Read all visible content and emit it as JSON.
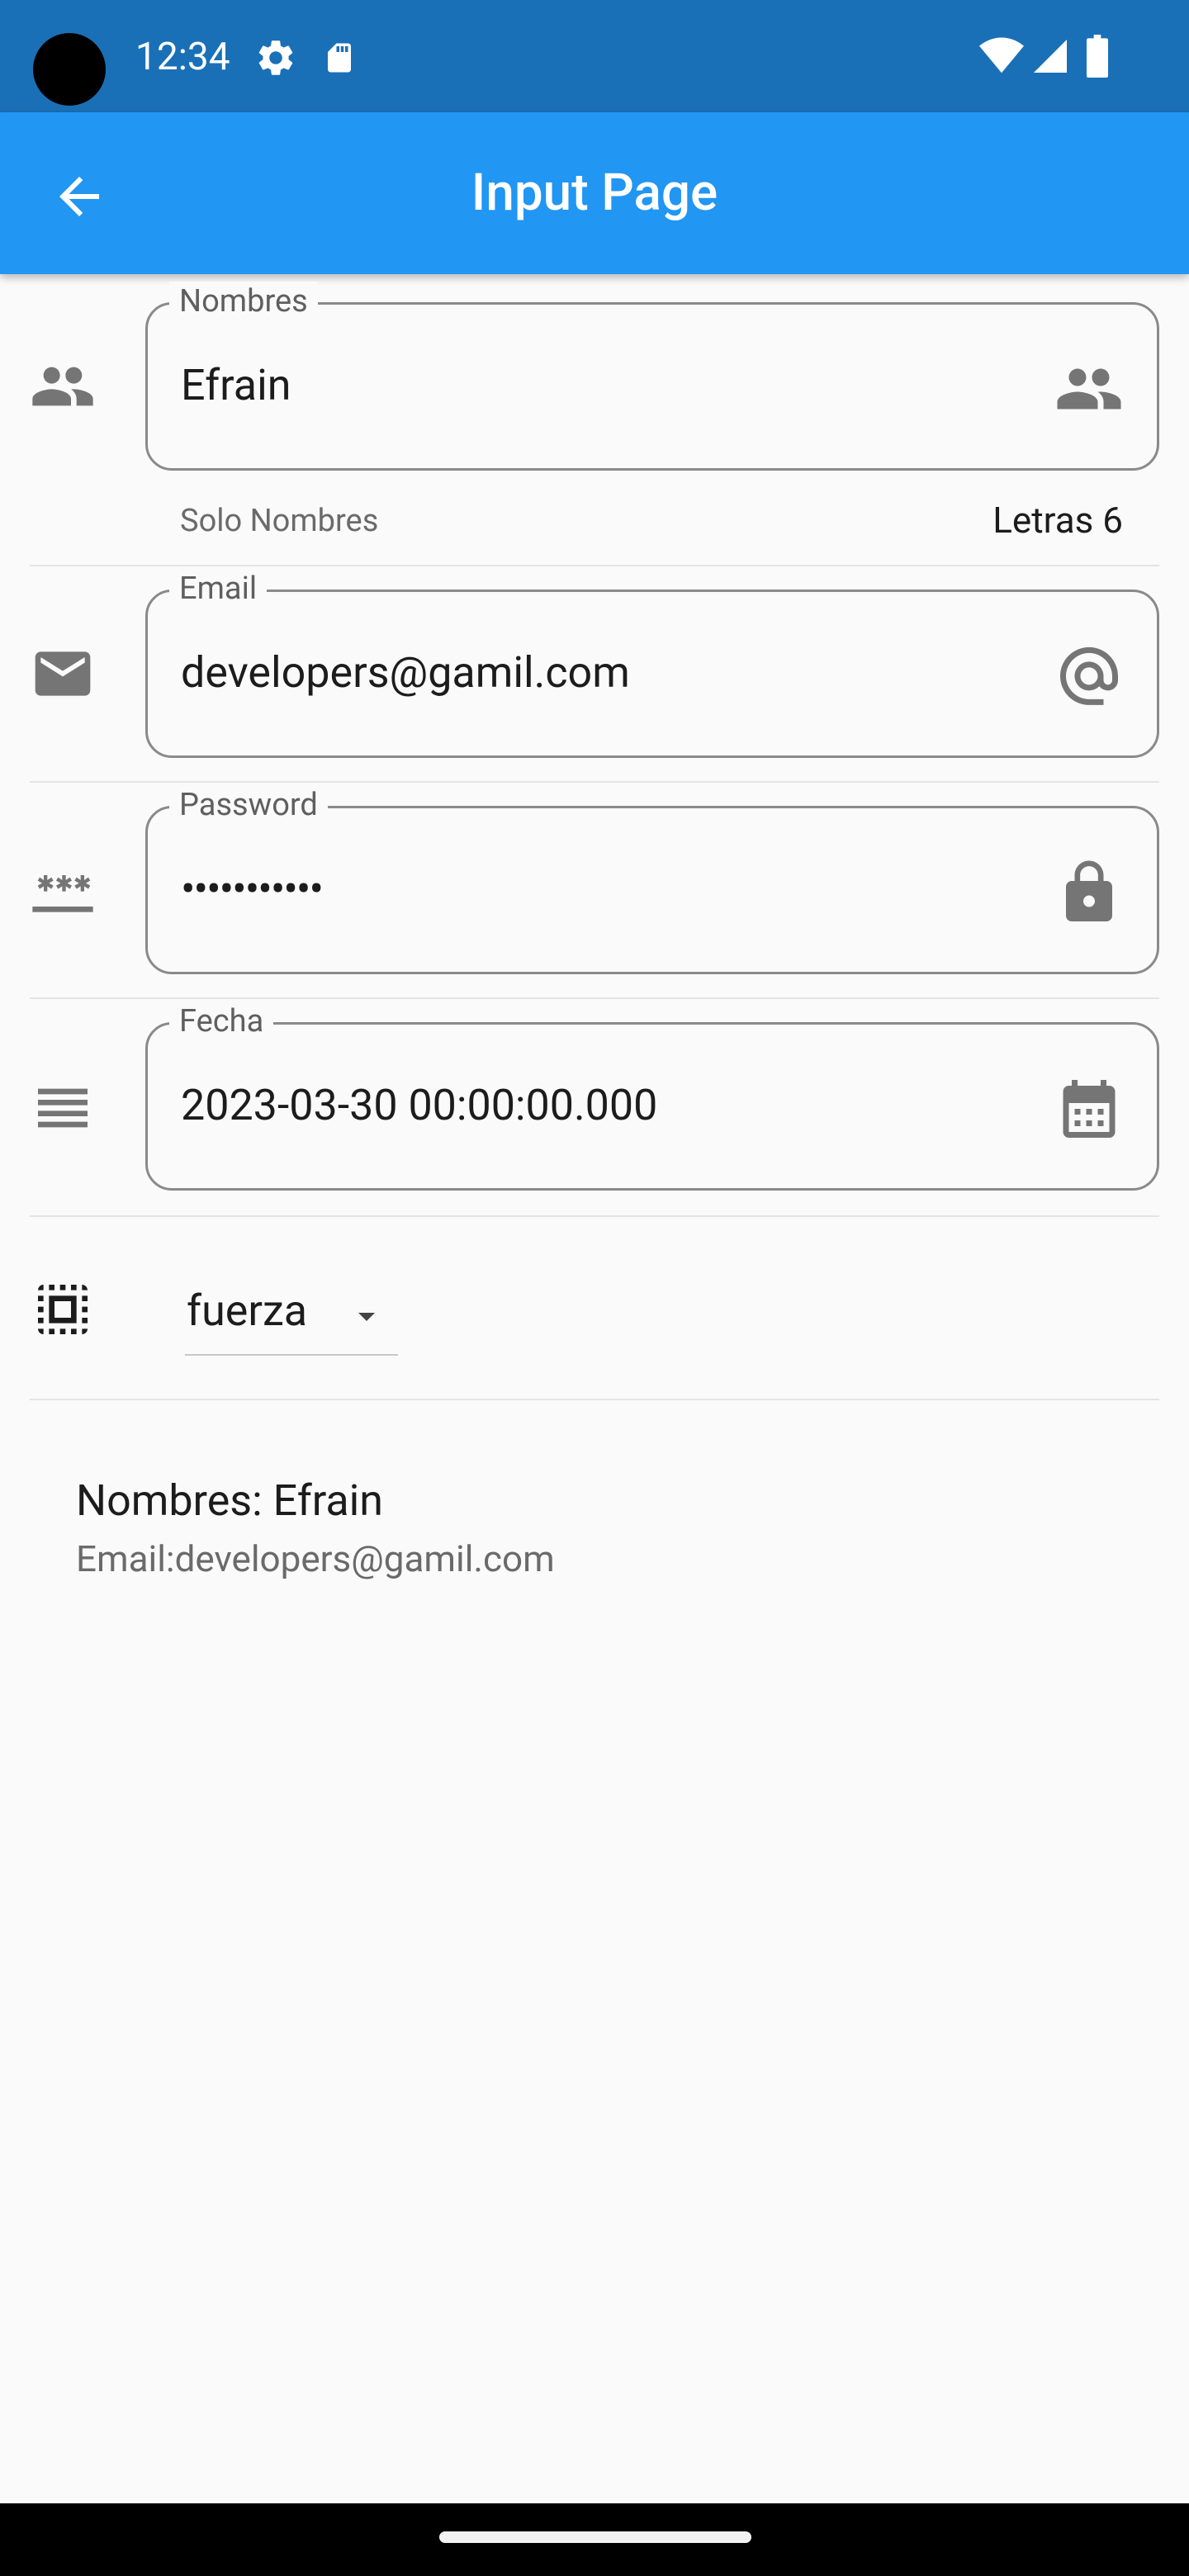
{
  "status_bar": {
    "time": "12:34",
    "icons": [
      "gear-icon",
      "sd-card-icon",
      "wifi-icon",
      "signal-icon",
      "battery-icon"
    ]
  },
  "app_bar": {
    "title": "Input Page",
    "back_icon": "arrow-back-icon"
  },
  "form": {
    "nombres": {
      "label": "Nombres",
      "value": "Efrain",
      "helper": "Solo Nombres",
      "counter": "Letras 6",
      "leading_icon": "people-icon",
      "trailing_icon": "people-icon"
    },
    "email": {
      "label": "Email",
      "value": "developers@gamil.com",
      "leading_icon": "mail-icon",
      "trailing_icon": "at-sign-icon"
    },
    "password": {
      "label": "Password",
      "value": "•••••••••••",
      "leading_icon": "password-icon",
      "trailing_icon": "lock-icon"
    },
    "fecha": {
      "label": "Fecha",
      "value": "2023-03-30 00:00:00.000",
      "leading_icon": "menu-lines-icon",
      "trailing_icon": "calendar-icon"
    },
    "dropdown": {
      "value": "fuerza",
      "leading_icon": "select-all-icon",
      "arrow_icon": "dropdown-arrow-icon"
    }
  },
  "summary": {
    "name_line": "Nombres: Efrain",
    "email_line": "Email:developers@gamil.com"
  },
  "colors": {
    "status_bar": "#1a70b7",
    "app_bar": "#2196f3",
    "background": "#fafafa",
    "outline": "#8a8a8a",
    "icon": "#757575"
  }
}
